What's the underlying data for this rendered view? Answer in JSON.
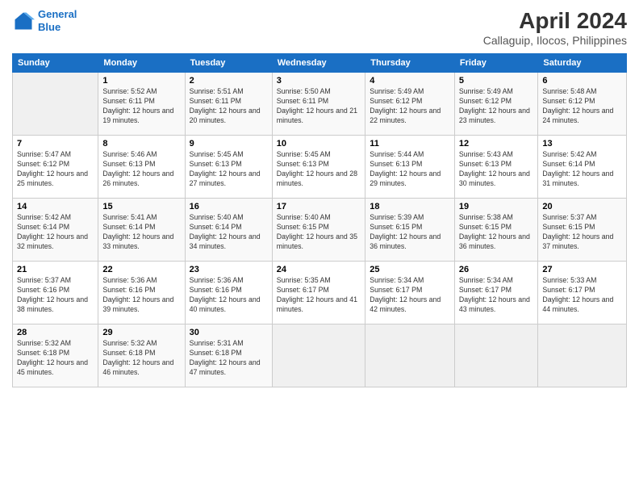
{
  "header": {
    "logo_line1": "General",
    "logo_line2": "Blue",
    "title": "April 2024",
    "subtitle": "Callaguip, Ilocos, Philippines"
  },
  "days_of_week": [
    "Sunday",
    "Monday",
    "Tuesday",
    "Wednesday",
    "Thursday",
    "Friday",
    "Saturday"
  ],
  "weeks": [
    [
      {
        "num": "",
        "sunrise": "",
        "sunset": "",
        "daylight": "",
        "empty": true
      },
      {
        "num": "1",
        "sunrise": "Sunrise: 5:52 AM",
        "sunset": "Sunset: 6:11 PM",
        "daylight": "Daylight: 12 hours and 19 minutes."
      },
      {
        "num": "2",
        "sunrise": "Sunrise: 5:51 AM",
        "sunset": "Sunset: 6:11 PM",
        "daylight": "Daylight: 12 hours and 20 minutes."
      },
      {
        "num": "3",
        "sunrise": "Sunrise: 5:50 AM",
        "sunset": "Sunset: 6:11 PM",
        "daylight": "Daylight: 12 hours and 21 minutes."
      },
      {
        "num": "4",
        "sunrise": "Sunrise: 5:49 AM",
        "sunset": "Sunset: 6:12 PM",
        "daylight": "Daylight: 12 hours and 22 minutes."
      },
      {
        "num": "5",
        "sunrise": "Sunrise: 5:49 AM",
        "sunset": "Sunset: 6:12 PM",
        "daylight": "Daylight: 12 hours and 23 minutes."
      },
      {
        "num": "6",
        "sunrise": "Sunrise: 5:48 AM",
        "sunset": "Sunset: 6:12 PM",
        "daylight": "Daylight: 12 hours and 24 minutes."
      }
    ],
    [
      {
        "num": "7",
        "sunrise": "Sunrise: 5:47 AM",
        "sunset": "Sunset: 6:12 PM",
        "daylight": "Daylight: 12 hours and 25 minutes."
      },
      {
        "num": "8",
        "sunrise": "Sunrise: 5:46 AM",
        "sunset": "Sunset: 6:13 PM",
        "daylight": "Daylight: 12 hours and 26 minutes."
      },
      {
        "num": "9",
        "sunrise": "Sunrise: 5:45 AM",
        "sunset": "Sunset: 6:13 PM",
        "daylight": "Daylight: 12 hours and 27 minutes."
      },
      {
        "num": "10",
        "sunrise": "Sunrise: 5:45 AM",
        "sunset": "Sunset: 6:13 PM",
        "daylight": "Daylight: 12 hours and 28 minutes."
      },
      {
        "num": "11",
        "sunrise": "Sunrise: 5:44 AM",
        "sunset": "Sunset: 6:13 PM",
        "daylight": "Daylight: 12 hours and 29 minutes."
      },
      {
        "num": "12",
        "sunrise": "Sunrise: 5:43 AM",
        "sunset": "Sunset: 6:13 PM",
        "daylight": "Daylight: 12 hours and 30 minutes."
      },
      {
        "num": "13",
        "sunrise": "Sunrise: 5:42 AM",
        "sunset": "Sunset: 6:14 PM",
        "daylight": "Daylight: 12 hours and 31 minutes."
      }
    ],
    [
      {
        "num": "14",
        "sunrise": "Sunrise: 5:42 AM",
        "sunset": "Sunset: 6:14 PM",
        "daylight": "Daylight: 12 hours and 32 minutes."
      },
      {
        "num": "15",
        "sunrise": "Sunrise: 5:41 AM",
        "sunset": "Sunset: 6:14 PM",
        "daylight": "Daylight: 12 hours and 33 minutes."
      },
      {
        "num": "16",
        "sunrise": "Sunrise: 5:40 AM",
        "sunset": "Sunset: 6:14 PM",
        "daylight": "Daylight: 12 hours and 34 minutes."
      },
      {
        "num": "17",
        "sunrise": "Sunrise: 5:40 AM",
        "sunset": "Sunset: 6:15 PM",
        "daylight": "Daylight: 12 hours and 35 minutes."
      },
      {
        "num": "18",
        "sunrise": "Sunrise: 5:39 AM",
        "sunset": "Sunset: 6:15 PM",
        "daylight": "Daylight: 12 hours and 36 minutes."
      },
      {
        "num": "19",
        "sunrise": "Sunrise: 5:38 AM",
        "sunset": "Sunset: 6:15 PM",
        "daylight": "Daylight: 12 hours and 36 minutes."
      },
      {
        "num": "20",
        "sunrise": "Sunrise: 5:37 AM",
        "sunset": "Sunset: 6:15 PM",
        "daylight": "Daylight: 12 hours and 37 minutes."
      }
    ],
    [
      {
        "num": "21",
        "sunrise": "Sunrise: 5:37 AM",
        "sunset": "Sunset: 6:16 PM",
        "daylight": "Daylight: 12 hours and 38 minutes."
      },
      {
        "num": "22",
        "sunrise": "Sunrise: 5:36 AM",
        "sunset": "Sunset: 6:16 PM",
        "daylight": "Daylight: 12 hours and 39 minutes."
      },
      {
        "num": "23",
        "sunrise": "Sunrise: 5:36 AM",
        "sunset": "Sunset: 6:16 PM",
        "daylight": "Daylight: 12 hours and 40 minutes."
      },
      {
        "num": "24",
        "sunrise": "Sunrise: 5:35 AM",
        "sunset": "Sunset: 6:17 PM",
        "daylight": "Daylight: 12 hours and 41 minutes."
      },
      {
        "num": "25",
        "sunrise": "Sunrise: 5:34 AM",
        "sunset": "Sunset: 6:17 PM",
        "daylight": "Daylight: 12 hours and 42 minutes."
      },
      {
        "num": "26",
        "sunrise": "Sunrise: 5:34 AM",
        "sunset": "Sunset: 6:17 PM",
        "daylight": "Daylight: 12 hours and 43 minutes."
      },
      {
        "num": "27",
        "sunrise": "Sunrise: 5:33 AM",
        "sunset": "Sunset: 6:17 PM",
        "daylight": "Daylight: 12 hours and 44 minutes."
      }
    ],
    [
      {
        "num": "28",
        "sunrise": "Sunrise: 5:32 AM",
        "sunset": "Sunset: 6:18 PM",
        "daylight": "Daylight: 12 hours and 45 minutes."
      },
      {
        "num": "29",
        "sunrise": "Sunrise: 5:32 AM",
        "sunset": "Sunset: 6:18 PM",
        "daylight": "Daylight: 12 hours and 46 minutes."
      },
      {
        "num": "30",
        "sunrise": "Sunrise: 5:31 AM",
        "sunset": "Sunset: 6:18 PM",
        "daylight": "Daylight: 12 hours and 47 minutes."
      },
      {
        "num": "",
        "sunrise": "",
        "sunset": "",
        "daylight": "",
        "empty": true
      },
      {
        "num": "",
        "sunrise": "",
        "sunset": "",
        "daylight": "",
        "empty": true
      },
      {
        "num": "",
        "sunrise": "",
        "sunset": "",
        "daylight": "",
        "empty": true
      },
      {
        "num": "",
        "sunrise": "",
        "sunset": "",
        "daylight": "",
        "empty": true
      }
    ]
  ]
}
